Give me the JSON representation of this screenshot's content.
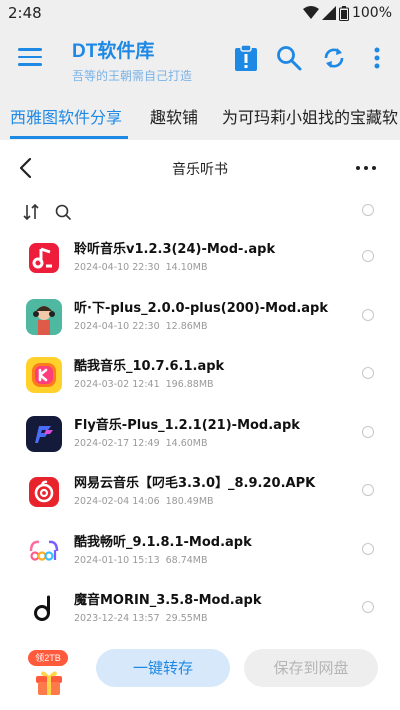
{
  "status": {
    "time": "2:48",
    "battery": "100%"
  },
  "appbar": {
    "title": "DT软件库",
    "subtitle": "吾等的王朝需自己打造"
  },
  "tabs": [
    "西雅图软件分享",
    "趣软铺",
    "为可玛莉小姐找的宝藏软"
  ],
  "folder": {
    "title": "音乐听书"
  },
  "files": [
    {
      "name": "聆听音乐v1.2.3(24)-Mod-.apk",
      "date": "2024-04-10 22:30",
      "size": "14.10MB",
      "icon": "lingting-music-icon"
    },
    {
      "name": "听·下-plus_2.0.0-plus(200)-Mod.apk",
      "date": "2024-04-10 22:30",
      "size": "12.86MB",
      "icon": "tingxia-icon"
    },
    {
      "name": "酷我音乐_10.7.6.1.apk",
      "date": "2024-03-02 12:41",
      "size": "196.88MB",
      "icon": "kuwo-music-icon"
    },
    {
      "name": "Fly音乐-Plus_1.2.1(21)-Mod.apk",
      "date": "2024-02-17 12:49",
      "size": "14.60MB",
      "icon": "fly-music-icon"
    },
    {
      "name": "网易云音乐【叼毛3.3.0】_8.9.20.APK",
      "date": "2024-02-04 14:06",
      "size": "180.49MB",
      "icon": "netease-music-icon"
    },
    {
      "name": "酷我畅听_9.1.8.1-Mod.apk",
      "date": "2024-01-10 15:13",
      "size": "68.74MB",
      "icon": "kuwo-changting-icon"
    },
    {
      "name": "魔音MORIN_3.5.8-Mod.apk",
      "date": "2023-12-24 13:57",
      "size": "29.55MB",
      "icon": "morin-icon"
    }
  ],
  "bottom": {
    "gift_badge": "领2TB",
    "primary_label": "一键转存",
    "secondary_label": "保存到网盘"
  },
  "colors": {
    "accent": "#1e88e5",
    "bar_bg": "#efefef"
  }
}
